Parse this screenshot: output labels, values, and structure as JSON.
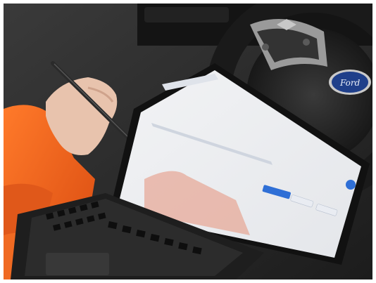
{
  "photo": {
    "subject": "tablet-in-car",
    "screen": {
      "header_title": "",
      "tabs": [
        "",
        "",
        "",
        "",
        "",
        "",
        "",
        ""
      ],
      "buttons": [
        "",
        "",
        ""
      ],
      "section_label": ""
    }
  },
  "colors": {
    "hi_vis_orange": "#f0641e",
    "seat_dark": "#2b2b2b",
    "screen_white": "#f4f5f7",
    "accent_blue": "#2f6fd6",
    "ford_blue": "#1f3f8a"
  },
  "icons": [
    "pen-icon",
    "steering-wheel-icon",
    "ford-logo-icon",
    "keyboard-icon",
    "profile-avatar-icon"
  ]
}
